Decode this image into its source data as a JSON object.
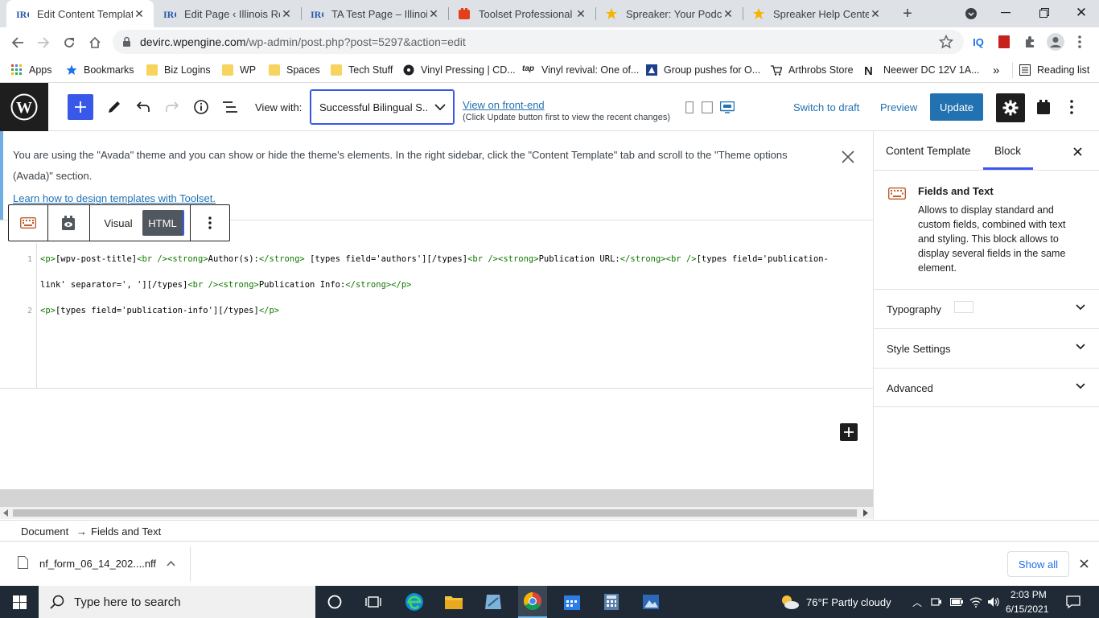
{
  "browser": {
    "tabs": [
      {
        "title": "Edit Content Template",
        "icon": "irc-logo-icon",
        "active": true
      },
      {
        "title": "Edit Page ‹ Illinois Resc",
        "icon": "irc-logo-icon",
        "active": false
      },
      {
        "title": "TA Test Page – Illinois R",
        "icon": "irc-logo-icon",
        "active": false
      },
      {
        "title": "Toolset Professional Su",
        "icon": "toolset-icon",
        "active": false
      },
      {
        "title": "Spreaker: Your Podcast",
        "icon": "spreaker-star-icon",
        "active": false
      },
      {
        "title": "Spreaker Help Center",
        "icon": "spreaker-star-icon",
        "active": false
      }
    ],
    "url_host": "devirc.wpengine.com",
    "url_path": "/wp-admin/post.php?post=5297&action=edit",
    "bookmarks": [
      {
        "label": "Apps",
        "icon": "apps-grid-icon"
      },
      {
        "label": "Bookmarks",
        "icon": "star-icon"
      },
      {
        "label": "Biz Logins",
        "icon": "folder-icon"
      },
      {
        "label": "WP",
        "icon": "folder-icon"
      },
      {
        "label": "Spaces",
        "icon": "folder-icon"
      },
      {
        "label": "Tech Stuff",
        "icon": "folder-icon"
      },
      {
        "label": "Vinyl Pressing | CD...",
        "icon": "vinyl-icon"
      },
      {
        "label": "Vinyl revival: One of...",
        "icon": "tap-icon"
      },
      {
        "label": "Group pushes for O...",
        "icon": "news-icon"
      },
      {
        "label": "Arthrobs Store",
        "icon": "cart-icon"
      },
      {
        "label": "Neewer DC 12V 1A...",
        "icon": "neewer-icon"
      }
    ],
    "reading_list": "Reading list"
  },
  "editor": {
    "view_with_label": "View with:",
    "view_with_value": "Successful Bilingual S...",
    "front_end_link": "View on front-end",
    "front_end_hint": "(Click Update button first to view the recent changes)",
    "switch_to_draft": "Switch to draft",
    "preview": "Preview",
    "update": "Update",
    "notice_text": "You are using the \"Avada\" theme and you can show or hide the theme's elements. In the right sidebar, click the \"Content Template\" tab and scroll to the \"Theme options (Avada)\" section.",
    "notice_link": "Learn how to design templates with Toolset.",
    "block_toolbar": {
      "visual": "Visual",
      "html": "HTML"
    },
    "code_lines": [
      {
        "num": "1",
        "parts": [
          {
            "t": "<p>",
            "c": "tag"
          },
          {
            "t": "[wpv-post-title]",
            "c": ""
          },
          {
            "t": "<br />",
            "c": "tag"
          },
          {
            "t": "<strong>",
            "c": "tag"
          },
          {
            "t": "Author(s):",
            "c": ""
          },
          {
            "t": "</strong>",
            "c": "tag"
          },
          {
            "t": " [types field='authors'][/types]",
            "c": ""
          },
          {
            "t": "<br />",
            "c": "tag"
          },
          {
            "t": "<strong>",
            "c": "tag"
          },
          {
            "t": "Publication URL:",
            "c": ""
          },
          {
            "t": "</strong>",
            "c": "tag"
          },
          {
            "t": "<br />",
            "c": "tag"
          },
          {
            "t": "[types field='publication-",
            "c": ""
          }
        ]
      },
      {
        "num": "",
        "parts": [
          {
            "t": "link' separator=', '][/types]",
            "c": ""
          },
          {
            "t": "<br />",
            "c": "tag"
          },
          {
            "t": "<strong>",
            "c": "tag"
          },
          {
            "t": "Publication Info:",
            "c": ""
          },
          {
            "t": "</strong>",
            "c": "tag"
          },
          {
            "t": "</p>",
            "c": "tag"
          }
        ]
      },
      {
        "num": "2",
        "parts": [
          {
            "t": "<p>",
            "c": "tag"
          },
          {
            "t": "[types field='publication-info'][/types]",
            "c": ""
          },
          {
            "t": "</p>",
            "c": "tag"
          }
        ]
      }
    ],
    "breadcrumb": {
      "root": "Document",
      "arrow": "→",
      "current": "Fields and Text"
    }
  },
  "sidebar": {
    "tabs": {
      "content_template": "Content Template",
      "block": "Block"
    },
    "block_title": "Fields and Text",
    "block_desc": "Allows to display standard and custom fields, combined with text and styling. This block allows to display several fields in the same element.",
    "panels": [
      "Typography",
      "Style Settings",
      "Advanced"
    ]
  },
  "downloads": {
    "file": "nf_form_06_14_202....nff",
    "show_all": "Show all"
  },
  "taskbar": {
    "search_placeholder": "Type here to search",
    "weather": "76°F  Partly cloudy",
    "time": "2:03 PM",
    "date": "6/15/2021"
  },
  "colors": {
    "wp_blue": "#3858e9",
    "update_button": "#2271b1",
    "link": "#2271b1"
  }
}
